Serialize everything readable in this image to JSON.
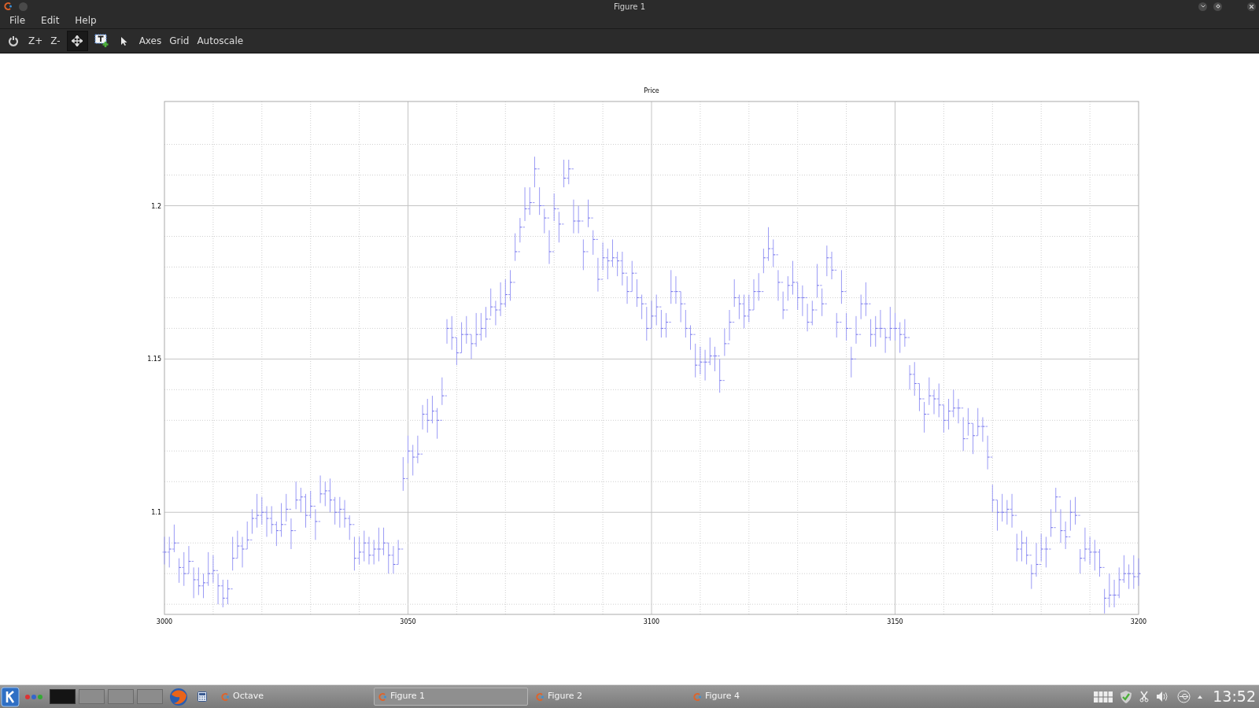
{
  "window": {
    "title": "Figure 1"
  },
  "menu": [
    "File",
    "Edit",
    "Help"
  ],
  "toolbar": {
    "zoom_buttons": [
      "Z+",
      "Z-"
    ],
    "pan_tool": {
      "selected": true
    },
    "text_buttons": [
      "Axes",
      "Grid",
      "Autoscale"
    ]
  },
  "plot": {
    "title": "Price",
    "x_tick_labels": [
      "3000",
      "3050",
      "3100",
      "3150",
      "3200"
    ],
    "y_tick_labels": [
      "1.2",
      "1.15",
      "1.1"
    ]
  },
  "taskbar": {
    "pager": [
      {
        "selected": true
      },
      {
        "selected": false
      },
      {
        "selected": false
      },
      {
        "selected": false
      }
    ],
    "tasks": [
      {
        "label": "Octave",
        "selected": false
      },
      {
        "label": "Figure 1",
        "selected": true
      },
      {
        "label": "Figure 2",
        "selected": false
      },
      {
        "label": "Figure 4",
        "selected": false
      }
    ],
    "clock": "13:52"
  }
}
